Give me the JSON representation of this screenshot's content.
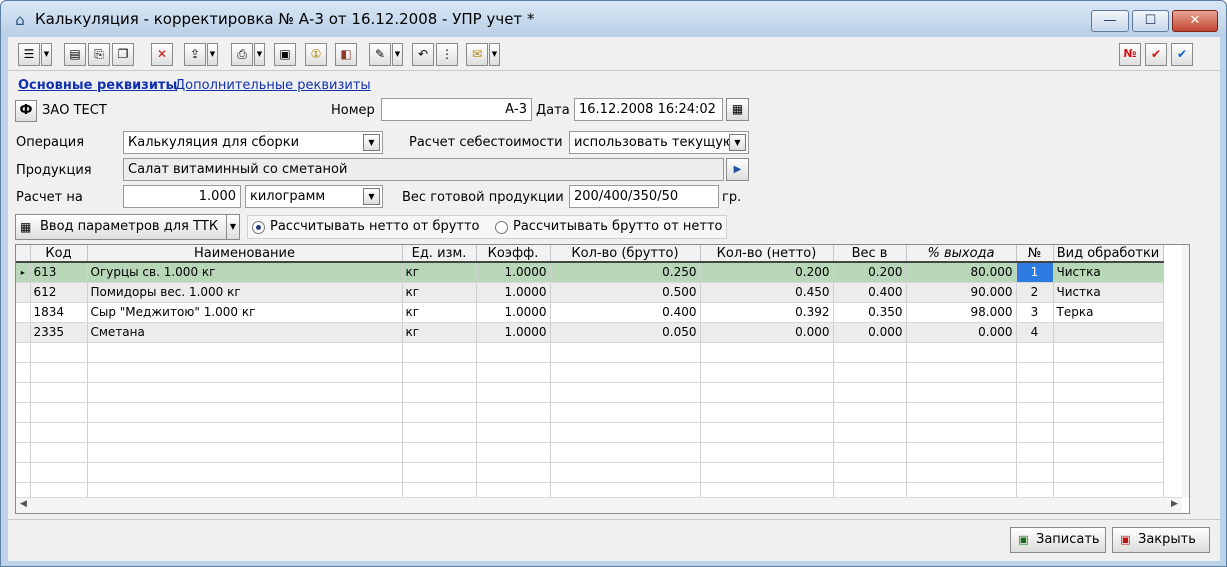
{
  "window": {
    "title": "Калькуляция - корректировка № А-3 от 16.12.2008 - УПР учет *",
    "min": "—",
    "max": "☐",
    "close": "✕"
  },
  "toolbar": {
    "icons": [
      "list-icon",
      "table-icon",
      "copy-icon",
      "copy2-icon",
      "delete-icon",
      "export-icon",
      "print-icon",
      "image-icon",
      "coin-icon",
      "book-icon",
      "edit-icon",
      "undo-icon",
      "structure-icon",
      "envelope-icon"
    ],
    "no_label": "№",
    "check_label": "✔",
    "check2_label": "✔"
  },
  "tabs": {
    "main": "Основные реквизиты",
    "extra": "Дополнительные реквизиты"
  },
  "org": {
    "btn": "Ф",
    "name": "ЗАО ТЕСТ"
  },
  "number": {
    "label": "Номер",
    "value": "А-3"
  },
  "date": {
    "label": "Дата",
    "value": "16.12.2008 16:24:02"
  },
  "operation": {
    "label": "Операция",
    "value": "Калькуляция для сборки"
  },
  "cost": {
    "label": "Расчет себестоимости",
    "value": "использовать текущую"
  },
  "product": {
    "label": "Продукция",
    "value": "Салат витаминный со сметаной"
  },
  "calc": {
    "label": "Расчет на",
    "qty": "1.000",
    "unit": "килограмм"
  },
  "weight": {
    "label": "Вес готовой продукции",
    "value": "200/400/350/50",
    "unit": "гр."
  },
  "calc_btn": "Ввод параметров для ТТК",
  "radio": {
    "opt1": "Рассчитывать нетто от брутто",
    "opt2": "Рассчитывать брутто от нетто"
  },
  "grid": {
    "headers": [
      "Код",
      "Наименование",
      "Ед. изм.",
      "Коэфф.",
      "Кол-во (брутто)",
      "Кол-во (нетто)",
      "Вес в",
      "% выхода",
      "№",
      "Вид обработки"
    ],
    "rows": [
      [
        "613",
        "Огурцы св. 1.000 кг",
        "кг",
        "1.0000",
        "0.250",
        "0.200",
        "0.200",
        "80.000",
        "1",
        "Чистка"
      ],
      [
        "612",
        "Помидоры вес. 1.000 кг",
        "кг",
        "1.0000",
        "0.500",
        "0.450",
        "0.400",
        "90.000",
        "2",
        "Чистка"
      ],
      [
        "1834",
        "Сыр \"Меджитою\" 1.000 кг",
        "кг",
        "1.0000",
        "0.400",
        "0.392",
        "0.350",
        "98.000",
        "3",
        "Терка"
      ],
      [
        "2335",
        "Сметана",
        "кг",
        "1.0000",
        "0.050",
        "0.000",
        "0.000",
        "0.000",
        "4",
        ""
      ]
    ]
  },
  "buttons": {
    "save": "Записать",
    "close": "Закрыть"
  }
}
